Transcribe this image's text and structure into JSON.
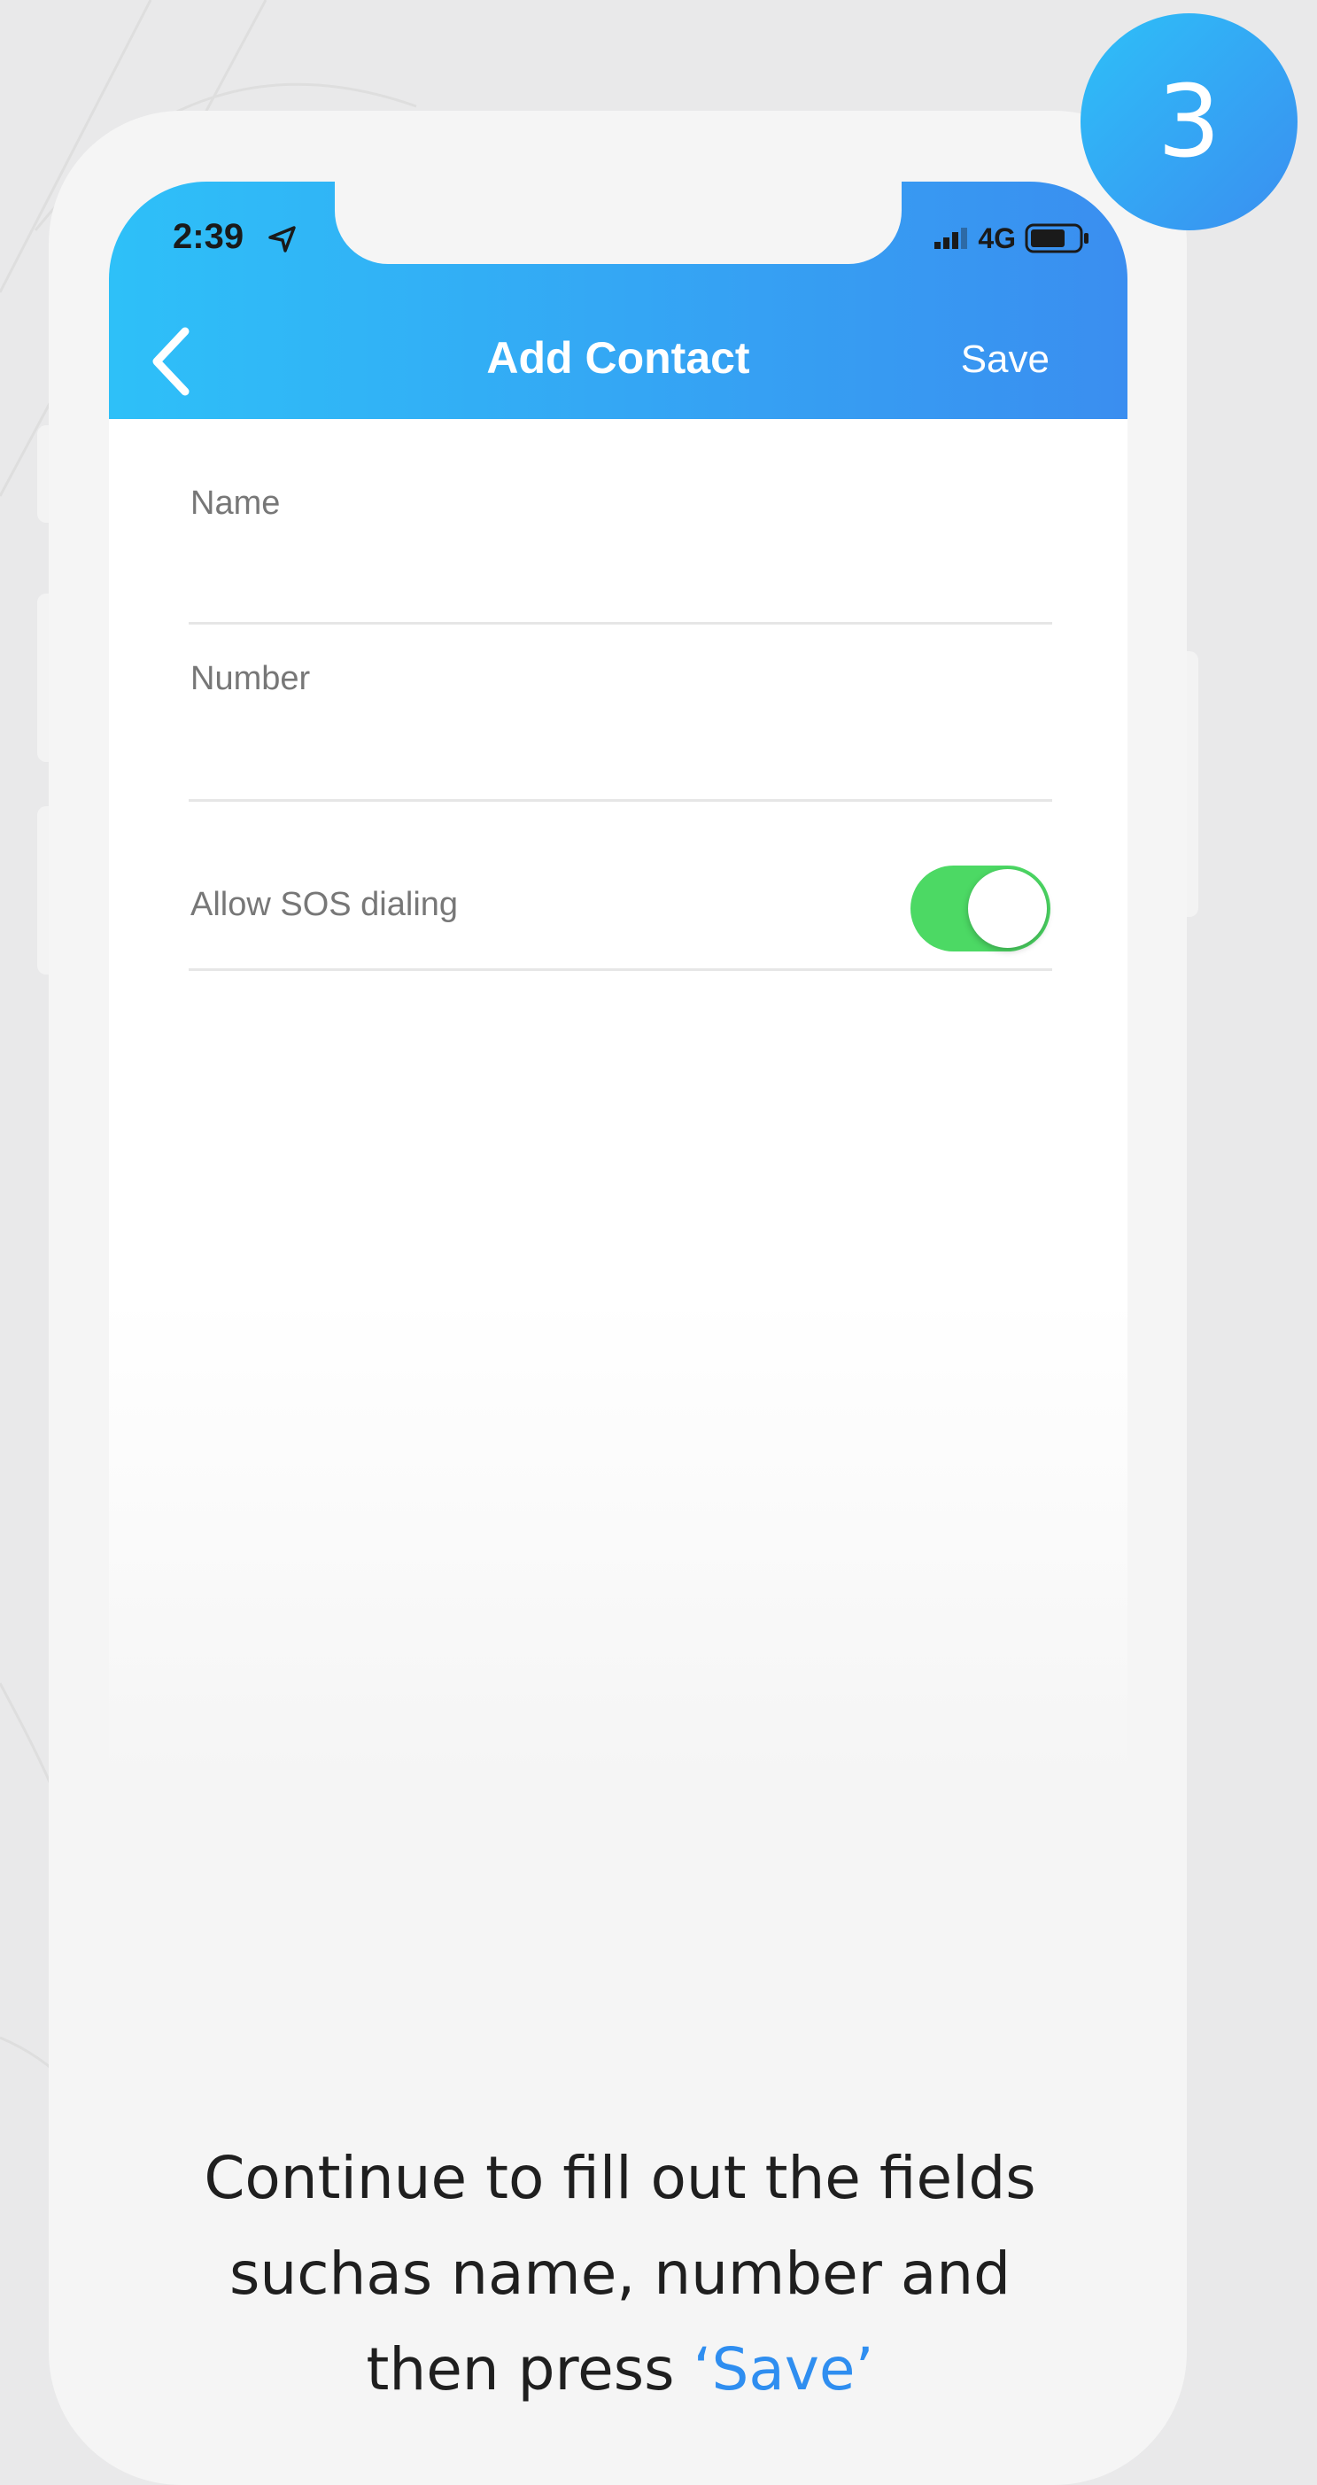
{
  "step_badge": "3",
  "status_bar": {
    "time": "2:39",
    "network": "4G"
  },
  "header": {
    "title": "Add Contact",
    "save_label": "Save"
  },
  "form": {
    "name_label": "Name",
    "name_value": "",
    "number_label": "Number",
    "number_value": "",
    "sos_label": "Allow SOS dialing",
    "sos_enabled": true
  },
  "instruction": {
    "line1": "Continue to fill out the fields",
    "line2": "suchas name, number and",
    "line3_prefix": "then press ",
    "line3_highlight": "‘Save’"
  },
  "colors": {
    "header_gradient_start": "#2ec0f8",
    "header_gradient_end": "#3a8ef0",
    "toggle_on": "#4cd964",
    "highlight": "#2f8ef0"
  }
}
